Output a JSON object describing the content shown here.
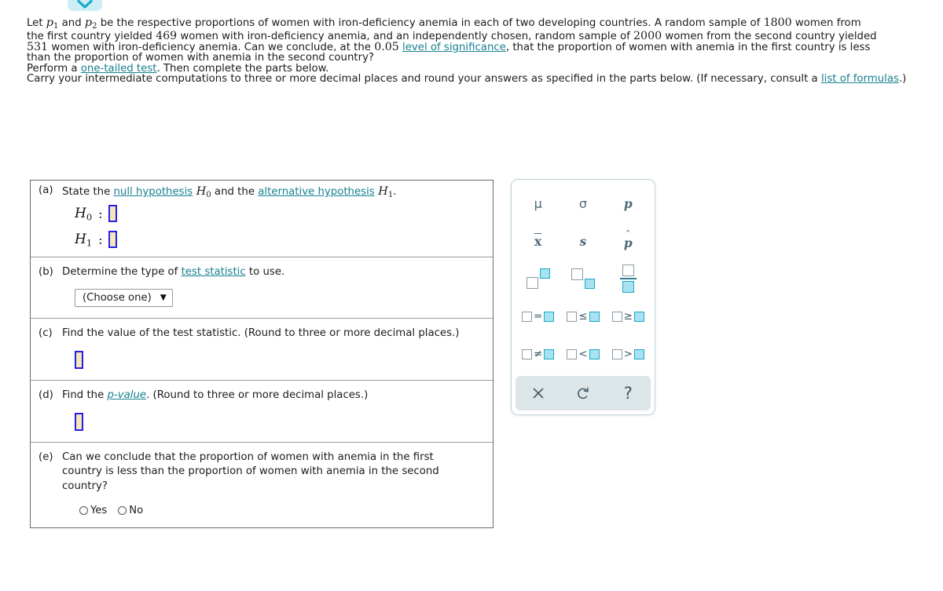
{
  "collapse_button": {
    "icon": "chevron-down-icon"
  },
  "problem": {
    "line1_pre": "Let ",
    "p1": "p",
    "p1_sub": "1",
    "line1_mid": " and ",
    "p2": "p",
    "p2_sub": "2",
    "line1_post": " be the respective proportions of women with iron-deficiency anemia in each of two developing countries. A random sample of ",
    "n1": "1800",
    "line1_end": " women from",
    "line2_pre": "the first country yielded ",
    "x1": "469",
    "line2_mid": " women with iron-deficiency anemia, and an independently chosen, random sample of ",
    "n2": "2000",
    "line2_end": " women from the second country yielded",
    "line3_pre": "",
    "x2": "531",
    "line3_mid": " women with iron-deficiency anemia. Can we conclude, at the ",
    "alpha": "0.05",
    "line3_space": " ",
    "link_significance": "level of significance",
    "line3_post": ", that the proportion of women with anemia in the first country is less",
    "line4": "than the proportion of women with anemia in the second country?",
    "perform_pre": "Perform a ",
    "link_onetailed": "one-tailed test",
    "perform_post": ". Then complete the parts below.",
    "carry_pre": "Carry your intermediate computations to three or more decimal places and round your answers as specified in the parts below. (If necessary, consult a ",
    "link_formulas": "list of formulas",
    "carry_post": ".)"
  },
  "parts": {
    "a": {
      "label": "(a)",
      "text_pre": "State the ",
      "link_null": "null hypothesis",
      "text_h0": " H",
      "text_h0_sub": "0",
      "text_mid": " and the ",
      "link_alt": "alternative hypothesis",
      "text_h1": " H",
      "text_h1_sub": "1",
      "text_end": ".",
      "h0_name": "H",
      "h0_sub": "0",
      "h1_name": "H",
      "h1_sub": "1",
      "colon": ":",
      "h0_value": "",
      "h1_value": ""
    },
    "b": {
      "label": "(b)",
      "text_pre": "Determine the type of ",
      "link_teststat": "test statistic",
      "text_post": " to use.",
      "dropdown_value": "(Choose one)",
      "dropdown_caret": "▼"
    },
    "c": {
      "label": "(c)",
      "text": "Find the value of the test statistic. (Round to three or more decimal places.)",
      "value": ""
    },
    "d": {
      "label": "(d)",
      "text_pre": "Find the ",
      "link_pvalue": "p-value",
      "text_post": ". (Round to three or more decimal places.)",
      "value": ""
    },
    "e": {
      "label": "(e)",
      "text": "Can we conclude that the proportion of women with anemia in the first country is less than the proportion of women with anemia in the second country?",
      "option_yes": "Yes",
      "option_no": "No",
      "selected": ""
    }
  },
  "palette": {
    "rows": [
      [
        {
          "name": "mu-symbol",
          "glyph": "μ"
        },
        {
          "name": "sigma-symbol",
          "glyph": "σ"
        },
        {
          "name": "p-symbol",
          "glyph": "p"
        }
      ],
      [
        {
          "name": "x-bar-symbol",
          "glyph": "x"
        },
        {
          "name": "s-symbol",
          "glyph": "s"
        },
        {
          "name": "p-hat-symbol",
          "glyph": "p",
          "hat": "ˆ"
        }
      ],
      [
        {
          "name": "superscript-template",
          "glyph": "□^□"
        },
        {
          "name": "subscript-template",
          "glyph": "□_□"
        },
        {
          "name": "fraction-template",
          "glyph": "□/□"
        }
      ],
      [
        {
          "name": "equals-template",
          "op": "="
        },
        {
          "name": "less-equal-template",
          "op": "≤"
        },
        {
          "name": "greater-equal-template",
          "op": "≥"
        }
      ],
      [
        {
          "name": "not-equal-template",
          "op": "≠"
        },
        {
          "name": "less-than-template",
          "op": "<"
        },
        {
          "name": "greater-than-template",
          "op": ">"
        }
      ]
    ],
    "actions": [
      {
        "name": "clear-icon",
        "glyph": "×"
      },
      {
        "name": "undo-icon",
        "glyph": "↺"
      },
      {
        "name": "help-icon",
        "glyph": "?"
      }
    ],
    "colors": {
      "symbol": "#4c6a78",
      "accent": "#19a9c9",
      "accent_fill": "#a8e2f0",
      "action_bar": "#dce5e8"
    }
  }
}
